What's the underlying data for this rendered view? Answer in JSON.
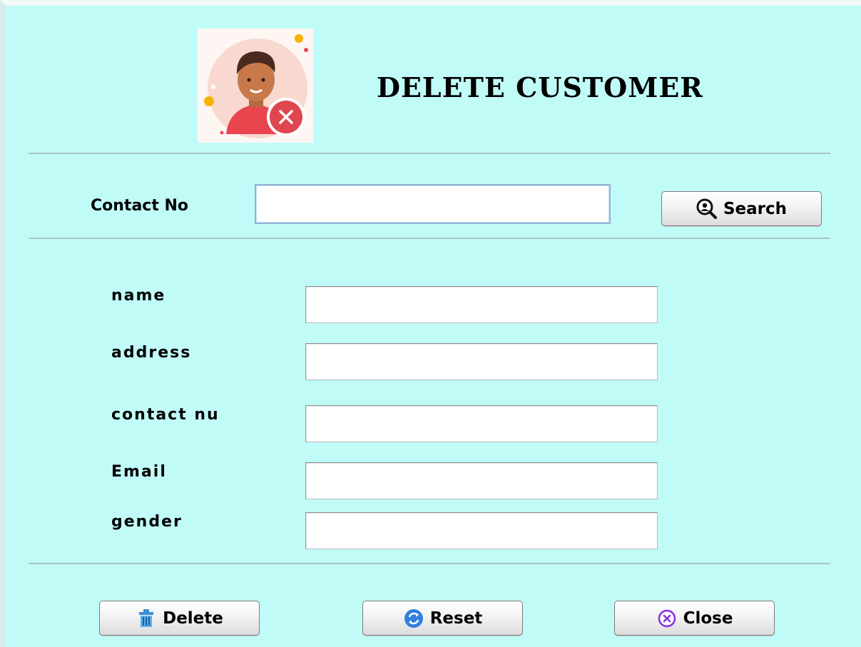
{
  "header": {
    "title": "DELETE CUSTOMER",
    "avatar_icon": "customer-remove-avatar"
  },
  "search": {
    "label": "Contact No",
    "value": "",
    "button_label": "Search",
    "button_icon": "search-user-icon"
  },
  "form": {
    "fields": [
      {
        "label": "name",
        "value": ""
      },
      {
        "label": "address",
        "value": ""
      },
      {
        "label": "contact nu",
        "value": ""
      },
      {
        "label": "Email",
        "value": ""
      },
      {
        "label": "gender",
        "value": ""
      }
    ]
  },
  "actions": {
    "delete_label": "Delete",
    "delete_icon": "trash-icon",
    "reset_label": "Reset",
    "reset_icon": "refresh-icon",
    "close_label": "Close",
    "close_icon": "close-circle-icon"
  },
  "colors": {
    "background": "#c0fbf8",
    "separator": "#aac4c6",
    "reset_icon": "#2f7fe0",
    "close_icon": "#8a2be2"
  }
}
